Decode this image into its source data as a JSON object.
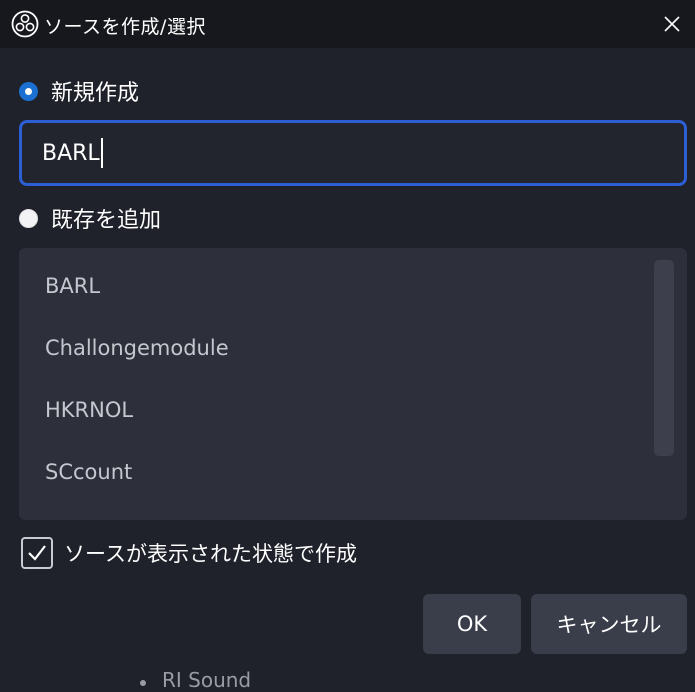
{
  "window": {
    "title": "ソースを作成/選択",
    "app_icon": "obs-logo-icon",
    "close_icon": "close-icon"
  },
  "create_new": {
    "label": "新規作成",
    "selected": true,
    "input_value": "BARL"
  },
  "add_existing": {
    "label": "既存を追加",
    "selected": false
  },
  "sources": [
    {
      "label": "BARL"
    },
    {
      "label": "Challongemodule"
    },
    {
      "label": "HKRNOL"
    },
    {
      "label": "SCcount"
    }
  ],
  "visible_checkbox": {
    "label": "ソースが表示された状態で作成",
    "checked": true
  },
  "buttons": {
    "ok": "OK",
    "cancel": "キャンセル"
  },
  "background_partial_text": "RI Sound",
  "colors": {
    "accent": "#2c5fd4",
    "radio_selected": "#1a6fd1",
    "dialog_bg": "#1f212b",
    "titlebar_bg": "#17181e",
    "list_bg": "#2d2f3b",
    "button_bg": "#3a3d4a"
  }
}
